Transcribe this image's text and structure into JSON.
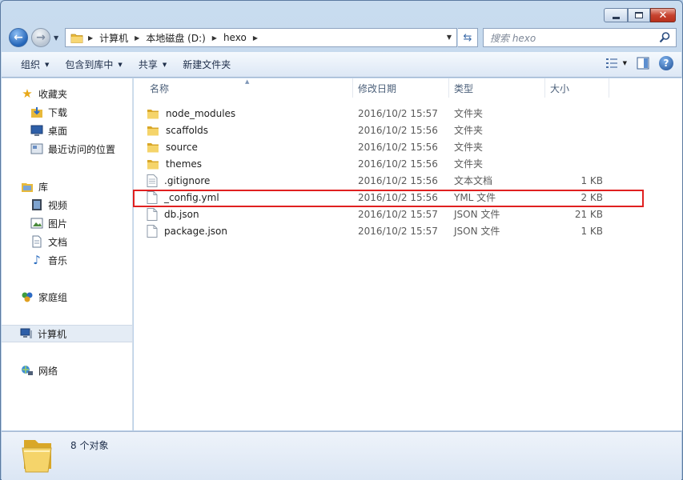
{
  "window": {
    "caption": {
      "minimize": "minimize",
      "maximize": "maximize",
      "close": "close"
    }
  },
  "address": {
    "crumbs": [
      "计算机",
      "本地磁盘 (D:)",
      "hexo"
    ]
  },
  "search": {
    "placeholder": "搜索 hexo"
  },
  "toolbar": {
    "organize": "组织",
    "include_library": "包含到库中",
    "share": "共享",
    "new_folder": "新建文件夹"
  },
  "navpane": {
    "favorites": "收藏夹",
    "downloads": "下载",
    "desktop": "桌面",
    "recent": "最近访问的位置",
    "libraries": "库",
    "videos": "视频",
    "pictures": "图片",
    "documents": "文档",
    "music": "音乐",
    "homegroup": "家庭组",
    "computer": "计算机",
    "network": "网络"
  },
  "columns": {
    "name": "名称",
    "date": "修改日期",
    "type": "类型",
    "size": "大小"
  },
  "files": [
    {
      "name": "node_modules",
      "date": "2016/10/2 15:57",
      "type": "文件夹",
      "size": "",
      "kind": "folder"
    },
    {
      "name": "scaffolds",
      "date": "2016/10/2 15:56",
      "type": "文件夹",
      "size": "",
      "kind": "folder"
    },
    {
      "name": "source",
      "date": "2016/10/2 15:56",
      "type": "文件夹",
      "size": "",
      "kind": "folder"
    },
    {
      "name": "themes",
      "date": "2016/10/2 15:56",
      "type": "文件夹",
      "size": "",
      "kind": "folder"
    },
    {
      "name": ".gitignore",
      "date": "2016/10/2 15:56",
      "type": "文本文档",
      "size": "1 KB",
      "kind": "text"
    },
    {
      "name": "_config.yml",
      "date": "2016/10/2 15:56",
      "type": "YML 文件",
      "size": "2 KB",
      "kind": "file"
    },
    {
      "name": "db.json",
      "date": "2016/10/2 15:57",
      "type": "JSON 文件",
      "size": "21 KB",
      "kind": "file"
    },
    {
      "name": "package.json",
      "date": "2016/10/2 15:57",
      "type": "JSON 文件",
      "size": "1 KB",
      "kind": "file"
    }
  ],
  "status": {
    "count": "8 个对象"
  },
  "colors": {
    "highlight": "#e02020",
    "folder": "#f2c94c"
  }
}
